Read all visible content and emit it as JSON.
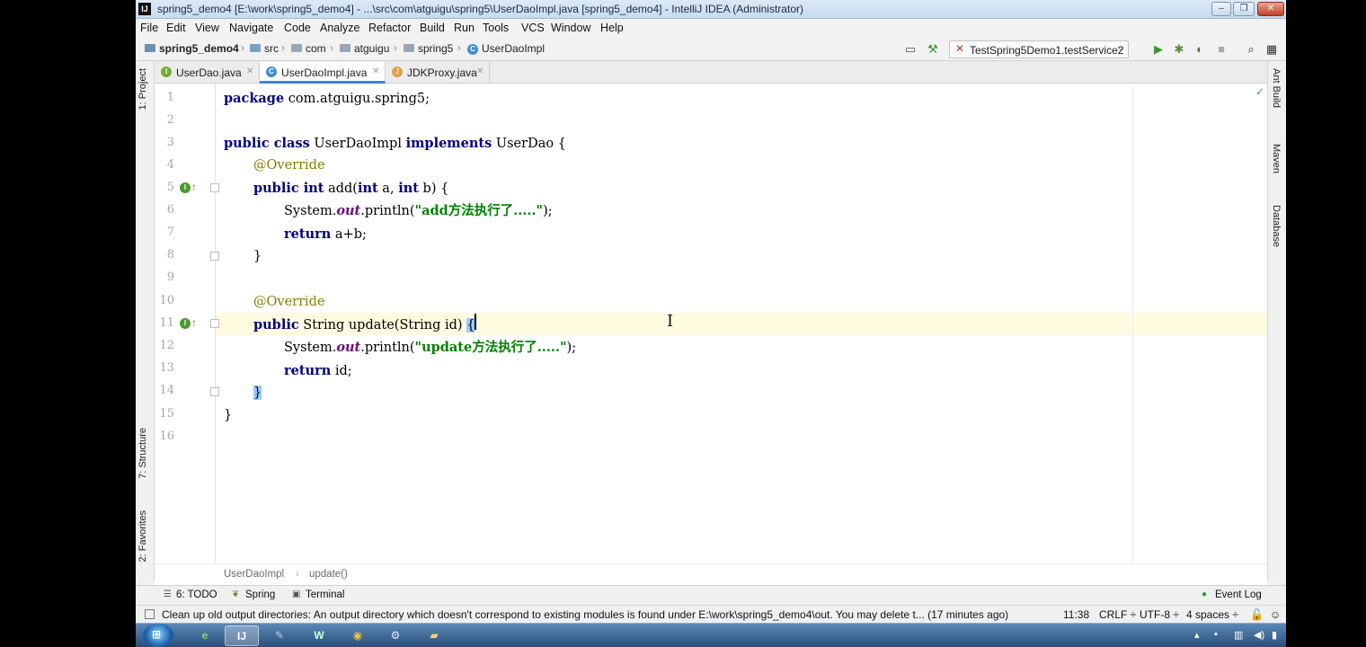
{
  "window": {
    "title": "spring5_demo4 [E:\\work\\spring5_demo4] - ...\\src\\com\\atguigu\\spring5\\UserDaoImpl.java [spring5_demo4] - IntelliJ IDEA (Administrator)",
    "app_icon_text": "IJ"
  },
  "menu": [
    "File",
    "Edit",
    "View",
    "Navigate",
    "Code",
    "Analyze",
    "Refactor",
    "Build",
    "Run",
    "Tools",
    "VCS",
    "Window",
    "Help"
  ],
  "navbar": {
    "crumbs": [
      "spring5_demo4",
      "src",
      "com",
      "atguigu",
      "spring5",
      "UserDaoImpl"
    ],
    "run_config": "TestSpring5Demo1.testService2"
  },
  "left_strip": {
    "project": "1: Project",
    "structure": "7: Structure",
    "favorites": "2: Favorites"
  },
  "right_strip": {
    "ant": "Ant Build",
    "maven": "Maven",
    "database": "Database"
  },
  "tabs": [
    {
      "label": "UserDao.java",
      "kind": "interface",
      "active": false
    },
    {
      "label": "UserDaoImpl.java",
      "kind": "class",
      "active": true
    },
    {
      "label": "JDKProxy.java",
      "kind": "java",
      "active": false
    }
  ],
  "editor": {
    "line_numbers": [
      "1",
      "2",
      "3",
      "4",
      "5",
      "6",
      "7",
      "8",
      "9",
      "10",
      "11",
      "12",
      "13",
      "14",
      "15",
      "16"
    ],
    "current_line": 11,
    "code": {
      "l1_kw": "package",
      "l1_rest": " com.atguigu.spring5;",
      "l3_kw1": "public class",
      "l3_name": " UserDaoImpl ",
      "l3_kw2": "implements",
      "l3_rest": " UserDao {",
      "l4_ann": "@Override",
      "l5_kw1": "public int",
      "l5_mid": " add(",
      "l5_kw2": "int",
      "l5_mid2": " a, ",
      "l5_kw3": "int",
      "l5_rest": " b) {",
      "l6_pre": "System.",
      "l6_field": "out",
      "l6_mid": ".println(",
      "l6_str": "\"add方法执行了.....\"",
      "l6_rest": ");",
      "l7_kw": "return",
      "l7_rest": " a+b;",
      "l8": "}",
      "l10_ann": "@Override",
      "l11_kw": "public",
      "l11_mid": " String update(String id) ",
      "l11_brace": "{",
      "l12_pre": "System.",
      "l12_field": "out",
      "l12_mid": ".println(",
      "l12_str": "\"update方法执行了.....\"",
      "l12_rest": ");",
      "l13_kw": "return",
      "l13_rest": " id;",
      "l14_brace": "}",
      "l15": "}"
    },
    "inspection": "✓"
  },
  "editor_breadcrumb": [
    "UserDaoImpl",
    "update()"
  ],
  "tool_windows": {
    "todo": "6: TODO",
    "spring": "Spring",
    "terminal": "Terminal",
    "event_log": "Event Log"
  },
  "status": {
    "message": "Clean up old output directories: An output directory which doesn't correspond to existing modules is found under E:\\work\\spring5_demo4\\out. You may delete t... (17 minutes ago)",
    "position": "11:38",
    "line_sep": "CRLF ÷",
    "encoding": "UTF-8 ÷",
    "indent": "4 spaces ÷"
  },
  "colors": {
    "keyword": "#000080",
    "annotation": "#808000",
    "string": "#008000",
    "caret_line": "#fffbe0",
    "brace_highlight": "#99ccff"
  }
}
